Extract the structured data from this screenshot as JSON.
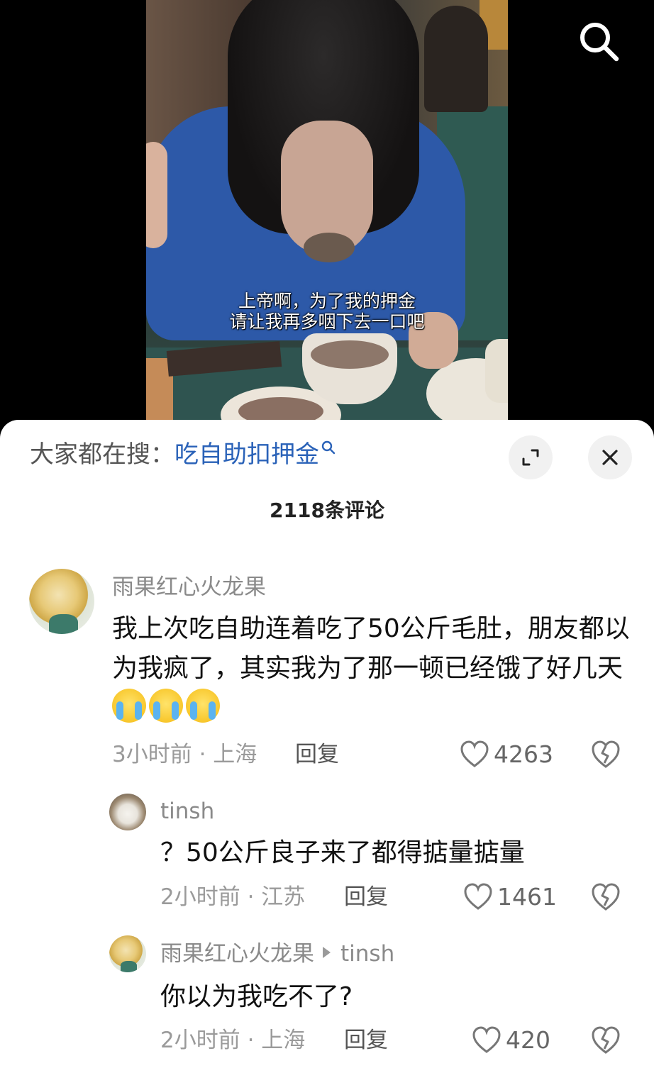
{
  "video": {
    "subtitle_line1": "上帝啊，为了我的押金",
    "subtitle_line2": "请让我再多咽下去一口吧"
  },
  "top_bar": {
    "search_icon": "search-icon"
  },
  "sheet": {
    "hot_search_prefix": "大家都在搜：",
    "hot_search_keyword": "吃自助扣押金",
    "expand_icon": "expand-icon",
    "close_icon": "close-icon",
    "comment_count": "2118条评论"
  },
  "comments": [
    {
      "author": "雨果红心火龙果",
      "text": "我上次吃自助连着吃了50公斤毛肚，朋友都以为我疯了，其实我为了那一顿已经饿了好几天",
      "emojis": [
        "crying-emoji",
        "crying-emoji",
        "crying-emoji"
      ],
      "time_location": "3小时前 · 上海",
      "reply_label": "回复",
      "likes": "4263"
    },
    {
      "author": "tinsh",
      "text": "？50公斤良子来了都得掂量掂量",
      "time_location": "2小时前 · 江苏",
      "reply_label": "回复",
      "likes": "1461"
    },
    {
      "author": "雨果红心火龙果",
      "reply_to": "tinsh",
      "text": "你以为我吃不了?",
      "time_location": "2小时前 · 上海",
      "reply_label": "回复",
      "likes": "420"
    }
  ]
}
